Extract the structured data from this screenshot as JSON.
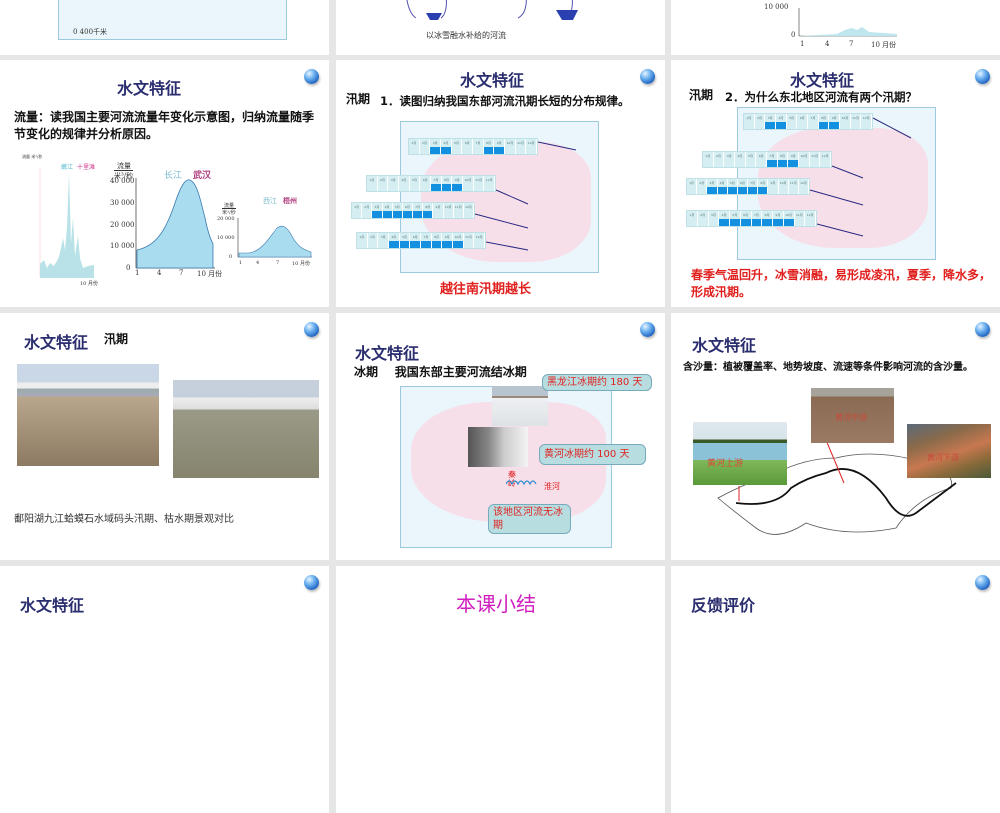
{
  "slides": {
    "top_left": {
      "scale": "0    400千米"
    },
    "top_middle": {
      "caption": "以冰雪融水补给的河流"
    },
    "top_right": {
      "y_ticks": [
        "10 000",
        "0"
      ],
      "x_ticks": [
        "1",
        "4",
        "7",
        "10 月份"
      ]
    },
    "flow": {
      "title": "水文特征",
      "body": "流量：读我国主要河流流量年变化示意图，归纳流量随季节变化的规律并分析原因。",
      "chart1": {
        "river": "嫩江",
        "station": "十里滩",
        "unit": "流量 米³/秒",
        "y_ticks": [
          "160 000",
          "140 000",
          "120 000",
          "100 000",
          "80 000",
          "60 000",
          "40 000",
          "20 000",
          "0"
        ],
        "x_ticks": [
          "1",
          "4",
          "7",
          "10 月份"
        ]
      },
      "chart2": {
        "river": "长江",
        "station": "武汉",
        "unit_top": "流量",
        "unit_bottom": "米³/秒",
        "y_ticks": [
          "40 000",
          "30 000",
          "20 000",
          "10 000",
          "0"
        ],
        "x_ticks": [
          "1",
          "4",
          "7",
          "10 月份"
        ]
      },
      "chart3": {
        "river": "西江",
        "station": "梧州",
        "unit_top": "流量",
        "unit_bottom": "米³/秒",
        "y_ticks": [
          "20 000",
          "10 000",
          "0"
        ],
        "x_ticks": [
          "1",
          "4",
          "7",
          "10 月份"
        ]
      }
    },
    "flood1": {
      "title": "水文特征",
      "label": "汛期",
      "question": "1．读图归纳我国东部河流汛期长短的分布规律。",
      "answer": "越往南汛期越长"
    },
    "flood2": {
      "title": "水文特征",
      "label": "汛期",
      "question": "2．为什么东北地区河流有两个汛期？",
      "answer": "春季气温回升，冰雪消融，易形成凌汛，夏季，降水多，形成汛期。"
    },
    "photos": {
      "title": "水文特征",
      "label": "汛期",
      "caption": "鄱阳湖九江蛤蟆石水域码头汛期、枯水期景观对比"
    },
    "ice": {
      "title": "水文特征",
      "subtitle": "冰期    我国东部主要河流结冰期",
      "callout1": "黑龙江冰期约 180 天",
      "callout2": "黄河冰期约 100 天",
      "callout3": "该地区河流无冰期",
      "qinling": "秦岭",
      "huaihe": "淮河"
    },
    "sediment": {
      "title": "水文特征",
      "body": "含沙量：植被覆盖率、地势坡度、流速等条件影响河流的含沙量。",
      "photo1": "黄河上游",
      "photo2": "黄河中游",
      "photo3": "黄河下游"
    },
    "bottom_left": {
      "title": "水文特征"
    },
    "bottom_middle": {
      "title": "本课小结"
    },
    "bottom_right": {
      "title": "反馈评价"
    }
  },
  "months": [
    "1月",
    "2月",
    "3月",
    "4月",
    "5月",
    "6月",
    "7月",
    "8月",
    "9月",
    "10月",
    "11月",
    "12月"
  ]
}
